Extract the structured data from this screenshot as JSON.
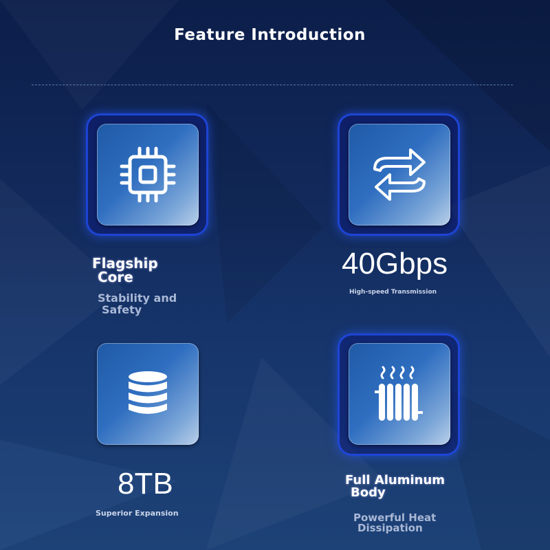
{
  "header": {
    "title": "Feature Introduction"
  },
  "features": [
    {
      "id": "core",
      "icon": "cpu-chip-icon",
      "heading_line1": "Flagship",
      "heading_line2": "Core",
      "sub_line1": "Stability and",
      "sub_line2": "Safety"
    },
    {
      "id": "speed",
      "icon": "transfer-arrows-icon",
      "value": "40Gbps",
      "sub": "High-speed Transmission"
    },
    {
      "id": "storage",
      "icon": "database-stack-icon",
      "value": "8TB",
      "sub": "Superior Expansion"
    },
    {
      "id": "body",
      "icon": "heat-radiator-icon",
      "heading_line1": "Full Aluminum",
      "heading_line2": "Body",
      "sub_line1": "Powerful Heat",
      "sub_line2": "Dissipation"
    }
  ],
  "colors": {
    "background": "#12295a",
    "card": "#2f6ec0",
    "glow": "#1e46dc",
    "subtext": "#a9b8d6"
  }
}
